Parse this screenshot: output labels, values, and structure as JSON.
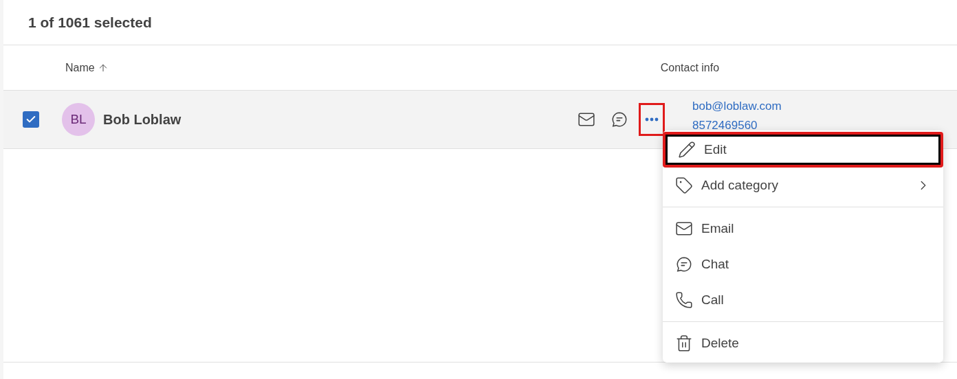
{
  "header": {
    "title": "1 of 1061 selected"
  },
  "columns": [
    {
      "label": "Name",
      "sorted": true
    },
    {
      "label": "Contact info",
      "sorted": false
    }
  ],
  "rows": [
    {
      "selected": true,
      "initials": "BL",
      "name": "Bob Loblaw",
      "email": "bob@loblaw.com",
      "phone": "8572469560",
      "more_highlighted": true
    }
  ],
  "menu": {
    "items": [
      {
        "kind": "item",
        "label": "Edit",
        "focused": true,
        "highlighted": true,
        "submenu": false
      },
      {
        "kind": "item",
        "label": "Add category",
        "focused": false,
        "highlighted": false,
        "submenu": true
      },
      {
        "kind": "divider"
      },
      {
        "kind": "item",
        "label": "Email",
        "focused": false,
        "highlighted": false,
        "submenu": false
      },
      {
        "kind": "item",
        "label": "Chat",
        "focused": false,
        "highlighted": false,
        "submenu": false
      },
      {
        "kind": "item",
        "label": "Call",
        "focused": false,
        "highlighted": false,
        "submenu": false
      },
      {
        "kind": "divider"
      },
      {
        "kind": "item",
        "label": "Delete",
        "focused": false,
        "highlighted": false,
        "submenu": false
      }
    ]
  }
}
